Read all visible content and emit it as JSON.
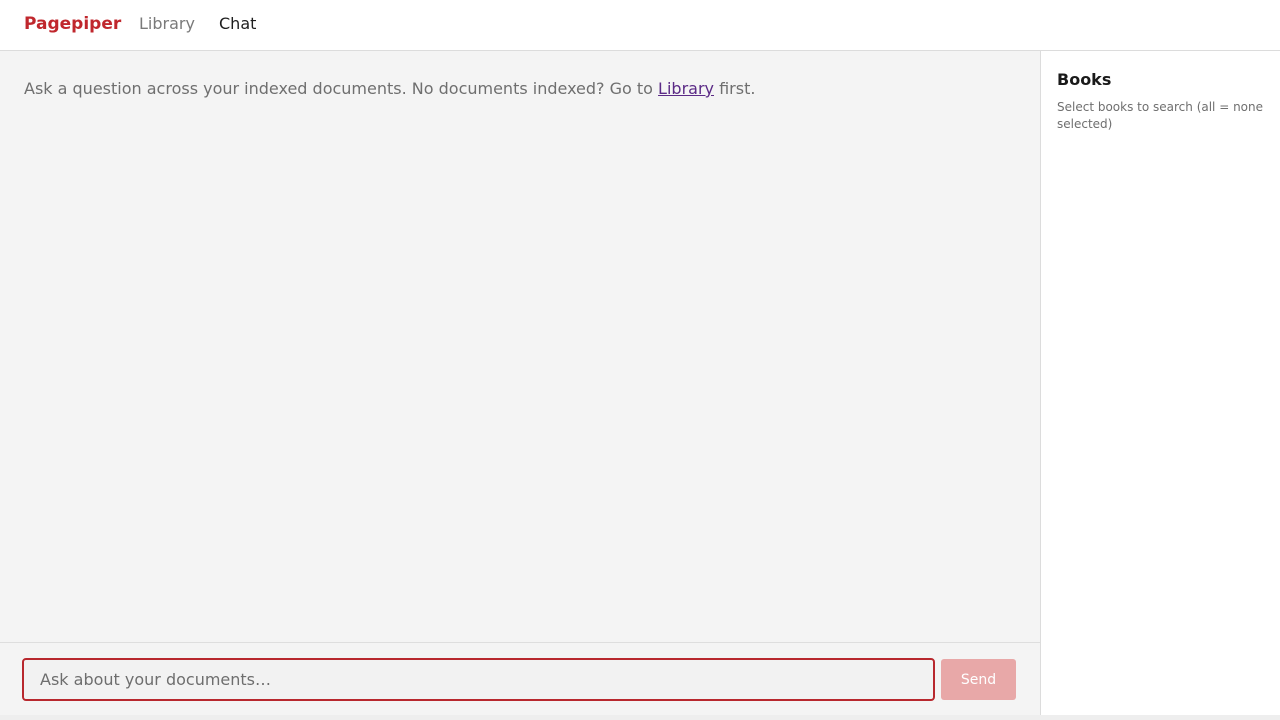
{
  "nav": {
    "brand": "Pagepiper",
    "links": [
      {
        "label": "Library"
      },
      {
        "label": "Chat"
      }
    ],
    "active": "Chat"
  },
  "main": {
    "intro_prefix": "Ask a question across your indexed documents. No documents indexed? Go to ",
    "intro_link": "Library",
    "intro_suffix": " first."
  },
  "composer": {
    "input_placeholder": "Ask about your documents…",
    "input_value": "",
    "send_label": "Send"
  },
  "sidebar": {
    "title": "Books",
    "hint": "Select books to search (all = none selected)"
  },
  "colors": {
    "brand": "#c0272d",
    "send_disabled": "#e8a8a8",
    "link_visited": "#5b2a86"
  }
}
